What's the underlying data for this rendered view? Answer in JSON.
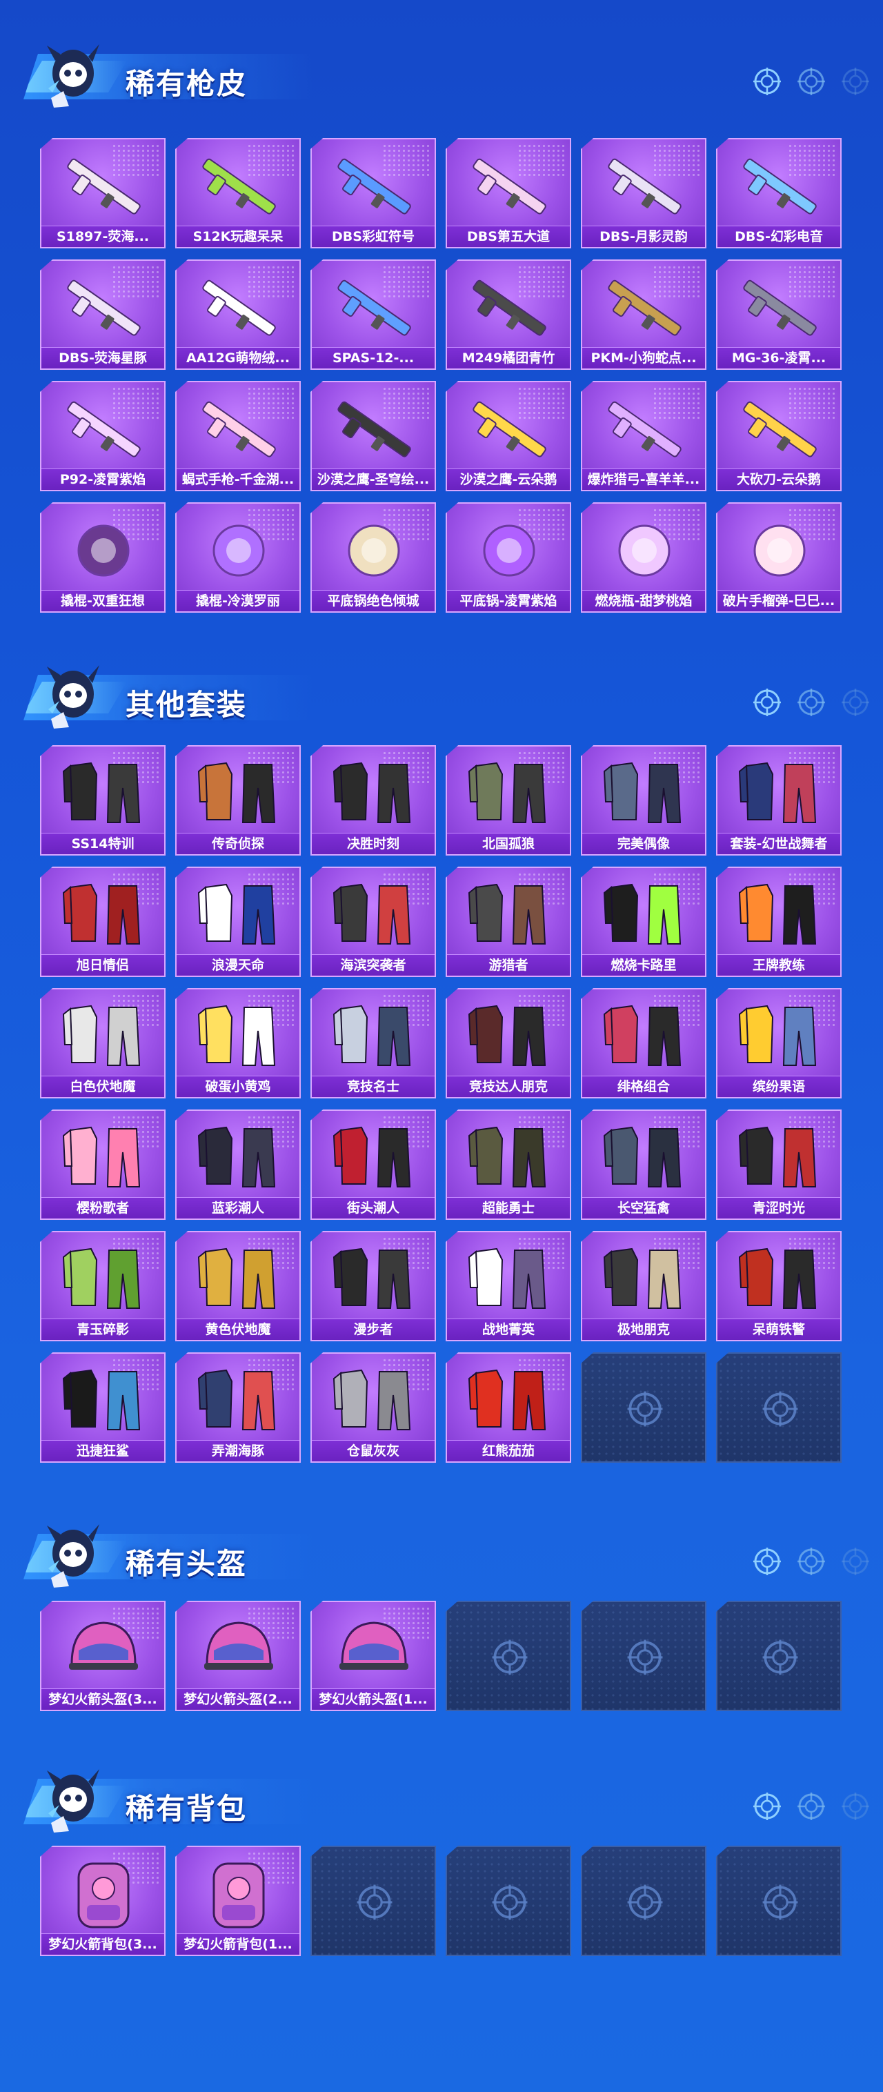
{
  "sections": [
    {
      "title": "稀有枪皮",
      "items": [
        "S1897-荧海...",
        "S12K玩趣呆呆",
        "DBS彩虹符号",
        "DBS第五大道",
        "DBS-月影灵韵",
        "DBS-幻彩电音",
        "DBS-荧海星豚",
        "AA12G萌物绒...",
        "SPAS-12-...",
        "M249橘团青竹",
        "PKM-小狗蛇点...",
        "MG-36-凌霄...",
        "P92-凌霄紫焰",
        "蝎式手枪-千金湖...",
        "沙漠之鹰-圣穹绘...",
        "沙漠之鹰-云朵鹅",
        "爆炸猎弓-喜羊羊...",
        "大砍刀-云朵鹅",
        "撬棍-双重狂想",
        "撬棍-冷漠罗丽",
        "平底锅绝色倾城",
        "平底锅-凌霄紫焰",
        "燃烧瓶-甜梦桃焰",
        "破片手榴弹-巳巳..."
      ],
      "empty_slots": 0
    },
    {
      "title": "其他套装",
      "items": [
        "SS14特训",
        "传奇侦探",
        "决胜时刻",
        "北国孤狼",
        "完美偶像",
        "套装-幻世战舞者",
        "旭日情侣",
        "浪漫天命",
        "海滨突袭者",
        "游猎者",
        "燃烧卡路里",
        "王牌教练",
        "白色伏地魔",
        "破蛋小黄鸡",
        "竞技名士",
        "竞技达人朋克",
        "绯格组合",
        "缤纷果语",
        "樱粉歌者",
        "蓝彩潮人",
        "街头潮人",
        "超能勇士",
        "长空猛禽",
        "青涩时光",
        "青玉碎影",
        "黄色伏地魔",
        "漫步者",
        "战地菁英",
        "极地朋克",
        "呆萌铁警",
        "迅捷狂鲨",
        "弄潮海豚",
        "仓鼠灰灰",
        "红熊茄茄"
      ],
      "empty_slots": 2
    },
    {
      "title": "稀有头盔",
      "items": [
        "梦幻火箭头盔(3...",
        "梦幻火箭头盔(2...",
        "梦幻火箭头盔(1..."
      ],
      "empty_slots": 3
    },
    {
      "title": "稀有背包",
      "items": [
        "梦幻火箭背包(3...",
        "梦幻火箭背包(1..."
      ],
      "empty_slots": 4
    }
  ],
  "icons": {
    "header_mascot": "mascot-icon",
    "header_target": "crosshair-icon",
    "empty_slot": "crosshair-icon"
  },
  "colors": {
    "background": "#1556d8",
    "card_purple": "#9c52e8",
    "label_purple": "#6a22c0",
    "empty_slot": "#263f7a"
  }
}
